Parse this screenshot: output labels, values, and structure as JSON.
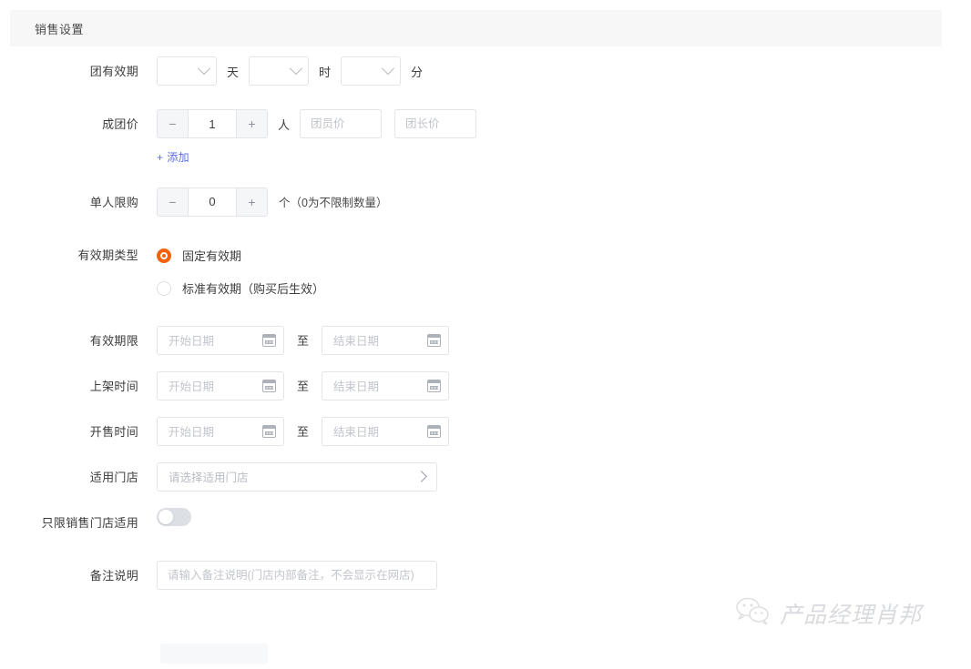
{
  "section": {
    "title": "销售设置"
  },
  "fields": {
    "group_validity": {
      "label": "团有效期",
      "day_value": "",
      "day_unit": "天",
      "hour_value": "",
      "hour_unit": "时",
      "minute_value": "",
      "minute_unit": "分"
    },
    "group_price": {
      "label": "成团价",
      "minus": "−",
      "count": "1",
      "plus": "+",
      "people_unit": "人",
      "member_price_placeholder": "团员价",
      "leader_price_placeholder": "团长价",
      "add_label": "添加",
      "add_plus": "+"
    },
    "purchase_limit": {
      "label": "单人限购",
      "minus": "−",
      "count": "0",
      "plus": "+",
      "hint": "个（0为不限制数量）"
    },
    "validity_type": {
      "label": "有效期类型",
      "options": [
        {
          "label": "固定有效期",
          "selected": true
        },
        {
          "label": "标准有效期（购买后生效）",
          "selected": false
        }
      ]
    },
    "validity_period": {
      "label": "有效期限",
      "start_placeholder": "开始日期",
      "separator": "至",
      "end_placeholder": "结束日期"
    },
    "shelf_time": {
      "label": "上架时间",
      "start_placeholder": "开始日期",
      "separator": "至",
      "end_placeholder": "结束日期"
    },
    "sale_time": {
      "label": "开售时间",
      "start_placeholder": "开始日期",
      "separator": "至",
      "end_placeholder": "结束日期"
    },
    "applicable_store": {
      "label": "适用门店",
      "placeholder": "请选择适用门店"
    },
    "sales_store_only": {
      "label": "只限销售门店适用",
      "enabled": false
    },
    "remark": {
      "label": "备注说明",
      "placeholder": "请输入备注说明(门店内部备注，不会显示在网店)"
    }
  },
  "watermark": {
    "text": "产品经理肖邦"
  },
  "colors": {
    "accent_orange": "#f3610c",
    "link_blue": "#5b6ee8",
    "header_bg": "#f7f7f8",
    "border": "#e2e4e8"
  }
}
